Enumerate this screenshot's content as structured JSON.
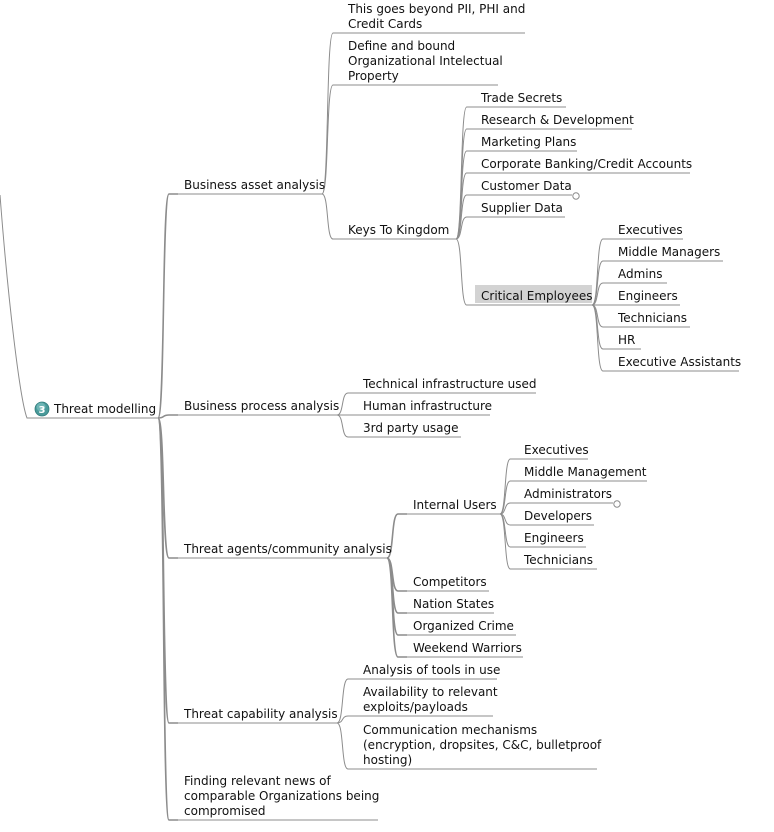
{
  "root": {
    "label": "Threat modelling",
    "badge": "3",
    "badge_color": "#4a9a9a"
  },
  "branches": [
    {
      "label": "Business asset analysis",
      "children": [
        {
          "label": "This goes beyond PII, PHI and Credit Cards",
          "lines": [
            "This goes beyond PII, PHI and",
            "Credit Cards"
          ]
        },
        {
          "label": "Define and bound Organizational Intelectual Property",
          "lines": [
            "Define and bound",
            "Organizational Intelectual",
            "Property"
          ]
        },
        {
          "label": "Keys To Kingdom",
          "children": [
            {
              "label": "Trade Secrets"
            },
            {
              "label": "Research & Development"
            },
            {
              "label": "Marketing Plans"
            },
            {
              "label": "Corporate Banking/Credit Accounts"
            },
            {
              "label": "Customer Data",
              "collapsed": true
            },
            {
              "label": "Supplier Data"
            },
            {
              "label": "Critical Employees",
              "selected": true,
              "children": [
                {
                  "label": "Executives"
                },
                {
                  "label": "Middle Managers"
                },
                {
                  "label": "Admins"
                },
                {
                  "label": "Engineers"
                },
                {
                  "label": "Technicians"
                },
                {
                  "label": "HR"
                },
                {
                  "label": "Executive Assistants"
                }
              ]
            }
          ]
        }
      ]
    },
    {
      "label": "Business process analysis",
      "children": [
        {
          "label": "Technical infrastructure used"
        },
        {
          "label": "Human infrastructure"
        },
        {
          "label": "3rd party usage"
        }
      ]
    },
    {
      "label": "Threat agents/community analysis",
      "children": [
        {
          "label": "Internal Users",
          "children": [
            {
              "label": "Executives"
            },
            {
              "label": "Middle Management"
            },
            {
              "label": "Administrators",
              "collapsed": true
            },
            {
              "label": "Developers"
            },
            {
              "label": "Engineers"
            },
            {
              "label": "Technicians"
            }
          ]
        },
        {
          "label": "Competitors"
        },
        {
          "label": "Nation States"
        },
        {
          "label": "Organized Crime"
        },
        {
          "label": "Weekend Warriors"
        }
      ]
    },
    {
      "label": "Threat capability analysis",
      "children": [
        {
          "label": "Analysis of tools in use"
        },
        {
          "label": "Availability to relevant exploits/payloads",
          "lines": [
            "Availability to relevant",
            "exploits/payloads"
          ]
        },
        {
          "label": "Communication mechanisms (encryption, dropsites, C&C, bulletproof hosting)",
          "lines": [
            "Communication mechanisms",
            "(encryption, dropsites, C&C, bulletproof",
            "hosting)"
          ]
        }
      ]
    },
    {
      "label": "Finding relevant news of comparable Organizations being compromised",
      "lines": [
        "Finding relevant news of",
        "comparable Organizations being",
        "compromised"
      ]
    }
  ],
  "colors": {
    "line": "#8c8c8c",
    "selected_bg": "#d3d3d3",
    "text": "#111111"
  }
}
